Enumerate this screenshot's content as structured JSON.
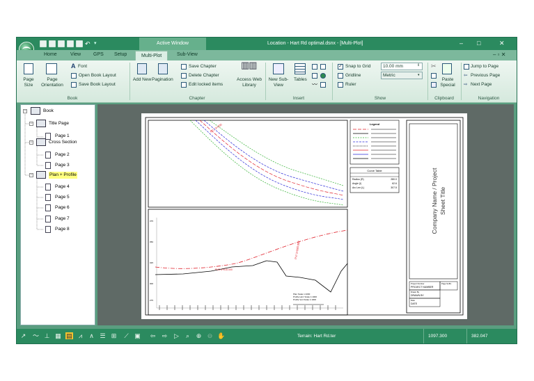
{
  "window": {
    "active_window_label": "Active Window",
    "title": "Location - Hart Rd optimal.dsnx - [Multi-Plot]",
    "minimize": "–",
    "maximize": "□",
    "close": "✕",
    "inner_controls": "– ▫ ✕"
  },
  "tabs": [
    {
      "label": "Home"
    },
    {
      "label": "View"
    },
    {
      "label": "GPS"
    },
    {
      "label": "Setup"
    },
    {
      "label": "Multi-Plot"
    },
    {
      "label": "Sub-View"
    }
  ],
  "ribbon": {
    "book": {
      "page_size": "Page Size",
      "page_orientation": "Page Orientation",
      "font": "Font",
      "open_book_layout": "Open Book Layout",
      "save_book_layout": "Save Book Layout",
      "group": "Book"
    },
    "chapter": {
      "add_new": "Add New",
      "pagination": "Pagination",
      "save_chapter": "Save Chapter",
      "delete_chapter": "Delete Chapter",
      "edit_locked_items": "Edit locked items",
      "access_web_library": "Access Web Library",
      "group": "Chapter"
    },
    "insert": {
      "new_sub_view": "New Sub-View",
      "tables": "Tables",
      "group": "Insert"
    },
    "show": {
      "snap_to_grid": "Snap to Grid",
      "snap_checked": true,
      "gridline": "Gridline",
      "ruler": "Ruler",
      "grid_value": "10.00 mm",
      "units_value": "Metric",
      "group": "Show"
    },
    "clipboard": {
      "paste_special": "Paste Special",
      "group": "Clipboard"
    },
    "navigation": {
      "jump_to_page": "Jump to Page",
      "previous_page": "Previous Page",
      "next_page": "Next Page",
      "group": "Navigation"
    }
  },
  "tree": {
    "root": "Book",
    "chapters": [
      {
        "label": "Title Page",
        "pages": [
          "Page 1"
        ]
      },
      {
        "label": "Cross Section",
        "pages": [
          "Page 2",
          "Page 3"
        ]
      },
      {
        "label": "Plan + Profile",
        "pages": [
          "Page 4",
          "Page 5",
          "Page 6",
          "Page 7",
          "Page 8"
        ],
        "selected": true
      }
    ]
  },
  "sheet": {
    "legend_title": "Legend",
    "curve_table_title": "Curve Table",
    "curve_rows": [
      {
        "label": "Radius (R)",
        "value": "280.0"
      },
      {
        "label": "Angle (I)",
        "value": "62.6"
      },
      {
        "label": "Arc Len (L)",
        "value": "307.5"
      }
    ],
    "title_block": "Company Name / Project Sheet Title",
    "box1_label": "Project Number",
    "box1_value": "PROJECT NUMBER",
    "box1_right": "Page Suffix",
    "box2_label": "Drawn By",
    "box2_value": "DRAWN BY",
    "box3_label": "Date",
    "box3_value": "DATE",
    "scale_notes": [
      "Plan Scale 1:1000",
      "Profile Horz Scale 1:1000",
      "Profile Vert Scale 1:1000"
    ],
    "plan_label": "P.C. 3+000",
    "profile_label1": "PVI 3+080.000",
    "profile_label2": "PVC 3+015.000"
  },
  "status": {
    "terrain": "Terrain: Hart Rd.ter",
    "x": "1097.300",
    "y": "382.047"
  },
  "colors": {
    "titlebar": "#2b8a5f",
    "accent_red": "#e0202a",
    "accent_blue": "#2a2ad8",
    "accent_green": "#30b030"
  }
}
